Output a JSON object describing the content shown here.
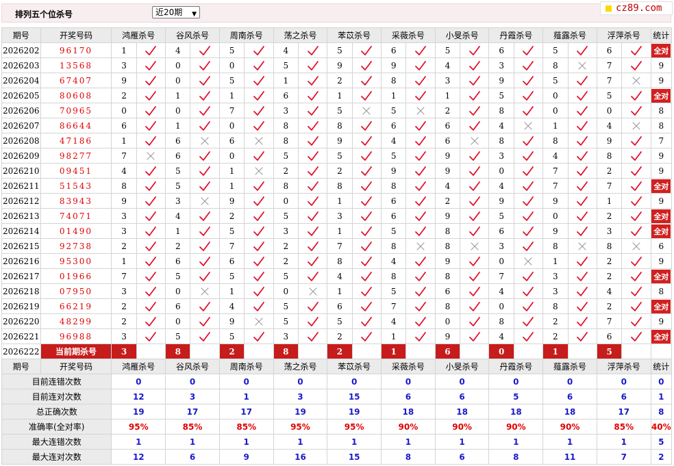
{
  "top": {
    "title": "排列五个位杀号",
    "select_value": "近20期",
    "logo": "cz89.com"
  },
  "headers": {
    "issue": "期号",
    "number": "开奖号码",
    "methods": [
      "鸿雁杀号",
      "谷风杀号",
      "周南杀号",
      "荡之杀号",
      "苯苡杀号",
      "采薇杀号",
      "小旻杀号",
      "丹霞杀号",
      "薤露杀号",
      "浮萍杀号"
    ],
    "stat": "统计"
  },
  "rows": [
    {
      "issue": "2026202",
      "number": "96170",
      "vals": [
        "1",
        "4",
        "5",
        "4",
        "5",
        "6",
        "5",
        "6",
        "5",
        "6"
      ],
      "marks": [
        1,
        1,
        1,
        1,
        1,
        1,
        1,
        1,
        1,
        1
      ],
      "stat": "全对"
    },
    {
      "issue": "2026203",
      "number": "13568",
      "vals": [
        "3",
        "0",
        "0",
        "5",
        "9",
        "9",
        "4",
        "3",
        "8",
        "7"
      ],
      "marks": [
        1,
        1,
        1,
        1,
        1,
        1,
        1,
        1,
        0,
        1
      ],
      "stat": "9"
    },
    {
      "issue": "2026204",
      "number": "67407",
      "vals": [
        "9",
        "0",
        "5",
        "1",
        "2",
        "8",
        "3",
        "9",
        "5",
        "7"
      ],
      "marks": [
        1,
        1,
        1,
        1,
        1,
        1,
        1,
        1,
        1,
        0
      ],
      "stat": "9"
    },
    {
      "issue": "2026205",
      "number": "80608",
      "vals": [
        "2",
        "1",
        "1",
        "6",
        "1",
        "1",
        "1",
        "5",
        "0",
        "5"
      ],
      "marks": [
        1,
        1,
        1,
        1,
        1,
        1,
        1,
        1,
        1,
        1
      ],
      "stat": "全对"
    },
    {
      "issue": "2026206",
      "number": "70965",
      "vals": [
        "0",
        "0",
        "7",
        "3",
        "5",
        "5",
        "2",
        "8",
        "0",
        "0"
      ],
      "marks": [
        1,
        1,
        1,
        1,
        0,
        0,
        1,
        1,
        1,
        1
      ],
      "stat": "8"
    },
    {
      "issue": "2026207",
      "number": "86644",
      "vals": [
        "6",
        "1",
        "0",
        "8",
        "8",
        "6",
        "6",
        "4",
        "1",
        "4"
      ],
      "marks": [
        1,
        1,
        1,
        1,
        1,
        1,
        1,
        0,
        1,
        0
      ],
      "stat": "8"
    },
    {
      "issue": "2026208",
      "number": "47186",
      "vals": [
        "1",
        "6",
        "6",
        "8",
        "9",
        "4",
        "6",
        "8",
        "8",
        "9"
      ],
      "marks": [
        1,
        0,
        0,
        1,
        1,
        1,
        0,
        1,
        1,
        1
      ],
      "stat": "7"
    },
    {
      "issue": "2026209",
      "number": "98277",
      "vals": [
        "7",
        "6",
        "0",
        "5",
        "5",
        "5",
        "9",
        "3",
        "4",
        "8"
      ],
      "marks": [
        0,
        1,
        1,
        1,
        1,
        1,
        1,
        1,
        1,
        1
      ],
      "stat": "9"
    },
    {
      "issue": "2026210",
      "number": "09451",
      "vals": [
        "4",
        "5",
        "1",
        "2",
        "2",
        "9",
        "9",
        "0",
        "7",
        "2"
      ],
      "marks": [
        1,
        1,
        0,
        1,
        1,
        1,
        1,
        1,
        1,
        1
      ],
      "stat": "9"
    },
    {
      "issue": "2026211",
      "number": "51543",
      "vals": [
        "8",
        "5",
        "1",
        "8",
        "8",
        "8",
        "4",
        "4",
        "7",
        "7"
      ],
      "marks": [
        1,
        1,
        1,
        1,
        1,
        1,
        1,
        1,
        1,
        1
      ],
      "stat": "全对"
    },
    {
      "issue": "2026212",
      "number": "83943",
      "vals": [
        "9",
        "3",
        "9",
        "0",
        "1",
        "6",
        "2",
        "9",
        "9",
        "1"
      ],
      "marks": [
        1,
        0,
        1,
        1,
        1,
        1,
        1,
        1,
        1,
        1
      ],
      "stat": "9"
    },
    {
      "issue": "2026213",
      "number": "74071",
      "vals": [
        "3",
        "4",
        "2",
        "5",
        "3",
        "6",
        "9",
        "5",
        "0",
        "2"
      ],
      "marks": [
        1,
        1,
        1,
        1,
        1,
        1,
        1,
        1,
        1,
        1
      ],
      "stat": "全对"
    },
    {
      "issue": "2026214",
      "number": "01490",
      "vals": [
        "3",
        "1",
        "5",
        "3",
        "1",
        "5",
        "8",
        "6",
        "9",
        "3"
      ],
      "marks": [
        1,
        1,
        1,
        1,
        1,
        1,
        1,
        1,
        1,
        1
      ],
      "stat": "全对"
    },
    {
      "issue": "2026215",
      "number": "92738",
      "vals": [
        "2",
        "2",
        "7",
        "2",
        "7",
        "8",
        "8",
        "3",
        "8",
        "8"
      ],
      "marks": [
        1,
        1,
        1,
        1,
        1,
        0,
        0,
        1,
        0,
        0
      ],
      "stat": "6"
    },
    {
      "issue": "2026216",
      "number": "95300",
      "vals": [
        "1",
        "6",
        "6",
        "2",
        "8",
        "4",
        "9",
        "0",
        "1",
        "2"
      ],
      "marks": [
        1,
        1,
        1,
        1,
        1,
        1,
        1,
        0,
        1,
        1
      ],
      "stat": "9"
    },
    {
      "issue": "2026217",
      "number": "01966",
      "vals": [
        "7",
        "5",
        "5",
        "5",
        "4",
        "8",
        "8",
        "7",
        "3",
        "2"
      ],
      "marks": [
        1,
        1,
        1,
        1,
        1,
        1,
        1,
        1,
        1,
        1
      ],
      "stat": "全对"
    },
    {
      "issue": "2026218",
      "number": "07950",
      "vals": [
        "3",
        "0",
        "1",
        "0",
        "1",
        "5",
        "6",
        "4",
        "3",
        "4"
      ],
      "marks": [
        1,
        0,
        1,
        0,
        1,
        1,
        1,
        1,
        1,
        1
      ],
      "stat": "8"
    },
    {
      "issue": "2026219",
      "number": "66219",
      "vals": [
        "2",
        "6",
        "4",
        "5",
        "6",
        "7",
        "8",
        "0",
        "8",
        "2"
      ],
      "marks": [
        1,
        1,
        1,
        1,
        1,
        1,
        1,
        1,
        1,
        1
      ],
      "stat": "全对"
    },
    {
      "issue": "2026220",
      "number": "48299",
      "vals": [
        "2",
        "0",
        "9",
        "5",
        "5",
        "4",
        "0",
        "8",
        "2",
        "7"
      ],
      "marks": [
        1,
        1,
        0,
        1,
        1,
        1,
        1,
        1,
        1,
        1
      ],
      "stat": "9"
    },
    {
      "issue": "2026221",
      "number": "96988",
      "vals": [
        "3",
        "5",
        "5",
        "3",
        "2",
        "1",
        "9",
        "4",
        "2",
        "6"
      ],
      "marks": [
        1,
        1,
        1,
        1,
        1,
        1,
        1,
        1,
        1,
        1
      ],
      "stat": "全对"
    }
  ],
  "current": {
    "issue": "2026222",
    "label": "当前期杀号",
    "vals": [
      "3",
      "8",
      "2",
      "8",
      "2",
      "1",
      "6",
      "0",
      "1",
      "5"
    ]
  },
  "stats": [
    {
      "label": "目前连错次数",
      "vals": [
        "0",
        "0",
        "0",
        "0",
        "0",
        "0",
        "0",
        "0",
        "0",
        "0"
      ],
      "stat": "0"
    },
    {
      "label": "目前连对次数",
      "vals": [
        "12",
        "3",
        "1",
        "3",
        "15",
        "6",
        "6",
        "5",
        "6",
        "6"
      ],
      "stat": "1"
    },
    {
      "label": "总正确次数",
      "vals": [
        "19",
        "17",
        "17",
        "19",
        "19",
        "18",
        "18",
        "18",
        "18",
        "17"
      ],
      "stat": "8"
    },
    {
      "label": "准确率(全对率)",
      "vals": [
        "95%",
        "85%",
        "85%",
        "95%",
        "95%",
        "90%",
        "90%",
        "90%",
        "90%",
        "85%"
      ],
      "stat": "40%",
      "rate": true
    },
    {
      "label": "最大连错次数",
      "vals": [
        "1",
        "1",
        "1",
        "1",
        "1",
        "1",
        "1",
        "1",
        "1",
        "1"
      ],
      "stat": "5"
    },
    {
      "label": "最大连对次数",
      "vals": [
        "12",
        "6",
        "9",
        "16",
        "15",
        "8",
        "6",
        "8",
        "11",
        "7"
      ],
      "stat": "2"
    }
  ],
  "icons": {
    "correct": "check-icon",
    "wrong": "cross-icon"
  }
}
